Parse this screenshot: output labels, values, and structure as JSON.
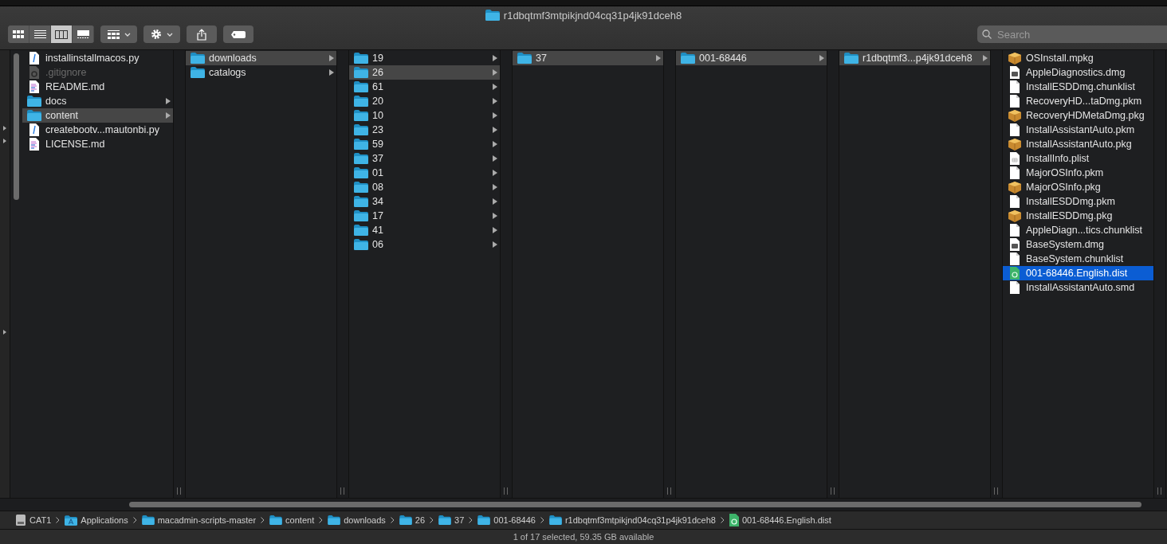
{
  "window": {
    "title": "r1dbqtmf3mtpikjnd04cq31p4jk91dceh8"
  },
  "toolbar": {
    "view_buttons": [
      {
        "kind": "icons",
        "selected": false
      },
      {
        "kind": "list",
        "selected": false
      },
      {
        "kind": "columns",
        "selected": true
      },
      {
        "kind": "gallery",
        "selected": false
      }
    ]
  },
  "search": {
    "placeholder": "Search"
  },
  "columns": [
    {
      "items": [
        {
          "name": "installinstallmacos.py",
          "kind": "script",
          "selected": false,
          "open": false,
          "dimmed": false
        },
        {
          "name": ".gitignore",
          "kind": "gear",
          "selected": false,
          "open": false,
          "dimmed": true
        },
        {
          "name": "README.md",
          "kind": "text",
          "selected": false,
          "open": false,
          "dimmed": false
        },
        {
          "name": "docs",
          "kind": "folder",
          "selected": false,
          "open": false,
          "dimmed": false
        },
        {
          "name": "content",
          "kind": "folder",
          "selected": false,
          "open": true,
          "dimmed": false
        },
        {
          "name": "createbootv...mautonbi.py",
          "kind": "script",
          "selected": false,
          "open": false,
          "dimmed": false
        },
        {
          "name": "LICENSE.md",
          "kind": "text",
          "selected": false,
          "open": false,
          "dimmed": false
        }
      ]
    },
    {
      "items": [
        {
          "name": "downloads",
          "kind": "folder",
          "selected": false,
          "open": true,
          "dimmed": false
        },
        {
          "name": "catalogs",
          "kind": "folder",
          "selected": false,
          "open": false,
          "dimmed": false
        }
      ]
    },
    {
      "items": [
        {
          "name": "19",
          "kind": "folder",
          "selected": false,
          "open": false,
          "dimmed": false
        },
        {
          "name": "26",
          "kind": "folder",
          "selected": false,
          "open": true,
          "dimmed": false
        },
        {
          "name": "61",
          "kind": "folder",
          "selected": false,
          "open": false,
          "dimmed": false
        },
        {
          "name": "20",
          "kind": "folder",
          "selected": false,
          "open": false,
          "dimmed": false
        },
        {
          "name": "10",
          "kind": "folder",
          "selected": false,
          "open": false,
          "dimmed": false
        },
        {
          "name": "23",
          "kind": "folder",
          "selected": false,
          "open": false,
          "dimmed": false
        },
        {
          "name": "59",
          "kind": "folder",
          "selected": false,
          "open": false,
          "dimmed": false
        },
        {
          "name": "37",
          "kind": "folder",
          "selected": false,
          "open": false,
          "dimmed": false
        },
        {
          "name": "01",
          "kind": "folder",
          "selected": false,
          "open": false,
          "dimmed": false
        },
        {
          "name": "08",
          "kind": "folder",
          "selected": false,
          "open": false,
          "dimmed": false
        },
        {
          "name": "34",
          "kind": "folder",
          "selected": false,
          "open": false,
          "dimmed": false
        },
        {
          "name": "17",
          "kind": "folder",
          "selected": false,
          "open": false,
          "dimmed": false
        },
        {
          "name": "41",
          "kind": "folder",
          "selected": false,
          "open": false,
          "dimmed": false
        },
        {
          "name": "06",
          "kind": "folder",
          "selected": false,
          "open": false,
          "dimmed": false
        }
      ]
    },
    {
      "items": [
        {
          "name": "37",
          "kind": "folder",
          "selected": false,
          "open": true,
          "dimmed": false
        }
      ]
    },
    {
      "items": [
        {
          "name": "001-68446",
          "kind": "folder",
          "selected": false,
          "open": true,
          "dimmed": false
        }
      ]
    },
    {
      "items": [
        {
          "name": "r1dbqtmf3...p4jk91dceh8",
          "kind": "folder",
          "selected": false,
          "open": true,
          "dimmed": false
        }
      ]
    },
    {
      "items": [
        {
          "name": "OSInstall.mpkg",
          "kind": "package",
          "selected": false,
          "open": false,
          "dimmed": false
        },
        {
          "name": "AppleDiagnostics.dmg",
          "kind": "disk",
          "selected": false,
          "open": false,
          "dimmed": false
        },
        {
          "name": "InstallESDDmg.chunklist",
          "kind": "plain",
          "selected": false,
          "open": false,
          "dimmed": false
        },
        {
          "name": "RecoveryHD...taDmg.pkm",
          "kind": "plain",
          "selected": false,
          "open": false,
          "dimmed": false
        },
        {
          "name": "RecoveryHDMetaDmg.pkg",
          "kind": "package",
          "selected": false,
          "open": false,
          "dimmed": false
        },
        {
          "name": "InstallAssistantAuto.pkm",
          "kind": "plain",
          "selected": false,
          "open": false,
          "dimmed": false
        },
        {
          "name": "InstallAssistantAuto.pkg",
          "kind": "package",
          "selected": false,
          "open": false,
          "dimmed": false
        },
        {
          "name": "InstallInfo.plist",
          "kind": "plist",
          "selected": false,
          "open": false,
          "dimmed": false
        },
        {
          "name": "MajorOSInfo.pkm",
          "kind": "plain",
          "selected": false,
          "open": false,
          "dimmed": false
        },
        {
          "name": "MajorOSInfo.pkg",
          "kind": "package",
          "selected": false,
          "open": false,
          "dimmed": false
        },
        {
          "name": "InstallESDDmg.pkm",
          "kind": "plain",
          "selected": false,
          "open": false,
          "dimmed": false
        },
        {
          "name": "InstallESDDmg.pkg",
          "kind": "package",
          "selected": false,
          "open": false,
          "dimmed": false
        },
        {
          "name": "AppleDiagn...tics.chunklist",
          "kind": "plain",
          "selected": false,
          "open": false,
          "dimmed": false
        },
        {
          "name": "BaseSystem.dmg",
          "kind": "disk",
          "selected": false,
          "open": false,
          "dimmed": false
        },
        {
          "name": "BaseSystem.chunklist",
          "kind": "plain",
          "selected": false,
          "open": false,
          "dimmed": false
        },
        {
          "name": "001-68446.English.dist",
          "kind": "dist",
          "selected": true,
          "open": false,
          "dimmed": false
        },
        {
          "name": "InstallAssistantAuto.smd",
          "kind": "plain",
          "selected": false,
          "open": false,
          "dimmed": false
        }
      ]
    }
  ],
  "path_bar": [
    {
      "name": "CAT1",
      "kind": "drive"
    },
    {
      "name": "Applications",
      "kind": "apps"
    },
    {
      "name": "macadmin-scripts-master",
      "kind": "folder"
    },
    {
      "name": "content",
      "kind": "folder"
    },
    {
      "name": "downloads",
      "kind": "folder"
    },
    {
      "name": "26",
      "kind": "folder"
    },
    {
      "name": "37",
      "kind": "folder"
    },
    {
      "name": "001-68446",
      "kind": "folder"
    },
    {
      "name": "r1dbqtmf3mtpikjnd04cq31p4jk91dceh8",
      "kind": "folder"
    },
    {
      "name": "001-68446.English.dist",
      "kind": "dist"
    }
  ],
  "status_bar": {
    "text": "1 of 17 selected, 59.35 GB available"
  }
}
